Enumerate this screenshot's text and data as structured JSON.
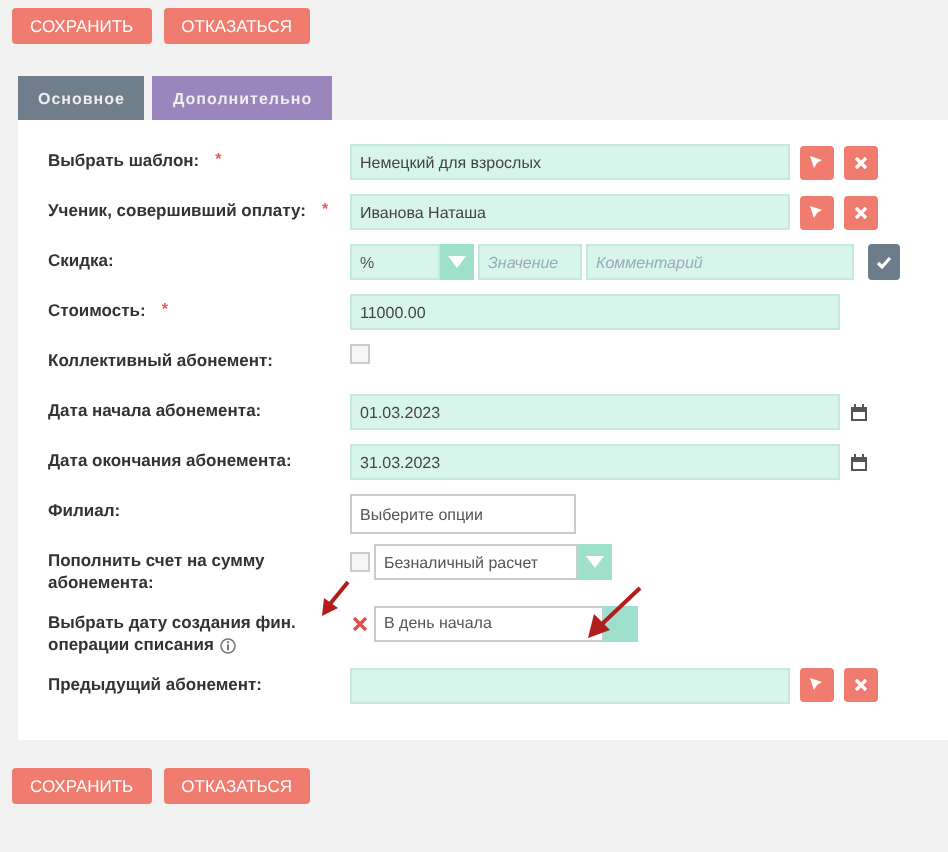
{
  "top_buttons": [
    "СОХРАНИТЬ",
    "ОТКАЗАТЬСЯ"
  ],
  "tabs": [
    {
      "label": "Основное",
      "selected": false
    },
    {
      "label": "Дополнительно",
      "selected": true
    }
  ],
  "rows": [
    {
      "kind": "lookup",
      "label": "Выбрать шаблон:",
      "required_mark": "*",
      "value": "Немецкий для взрослых"
    },
    {
      "kind": "lookup",
      "label": "Ученик, совершивший оплату:",
      "required_mark": "*",
      "value": "Иванова Наташа"
    },
    {
      "kind": "discount",
      "label": "Скидка:",
      "value": "%",
      "value_placeholder": "Значение",
      "comment_placeholder": "Комментарий"
    },
    {
      "kind": "text",
      "label": "Стоимость:",
      "required_mark": "*",
      "value": "11000.00"
    },
    {
      "kind": "checkbox",
      "label": "Коллективный абонемент:",
      "checked": false
    },
    {
      "kind": "date",
      "label": "Дата начала абонемента:",
      "value": "01.03.2023"
    },
    {
      "kind": "date",
      "label": "Дата окончания абонемента:",
      "value": "31.03.2023"
    },
    {
      "kind": "select",
      "label": "Филиал:",
      "placeholder": "Выберите опции"
    },
    {
      "kind": "checkbox_select",
      "label": "Пополнить счет на сумму абонемента:",
      "checked": false,
      "value": "Безналичный расчет"
    },
    {
      "kind": "x_select",
      "label": "Выбрать дату создания фин. операции списания",
      "info": true,
      "value": "В день начала"
    },
    {
      "kind": "lookup",
      "label": "Предыдущий абонемент:"
    }
  ],
  "bottom_buttons": [
    "СОХРАНИТЬ",
    "ОТКАЗАТЬСЯ"
  ]
}
